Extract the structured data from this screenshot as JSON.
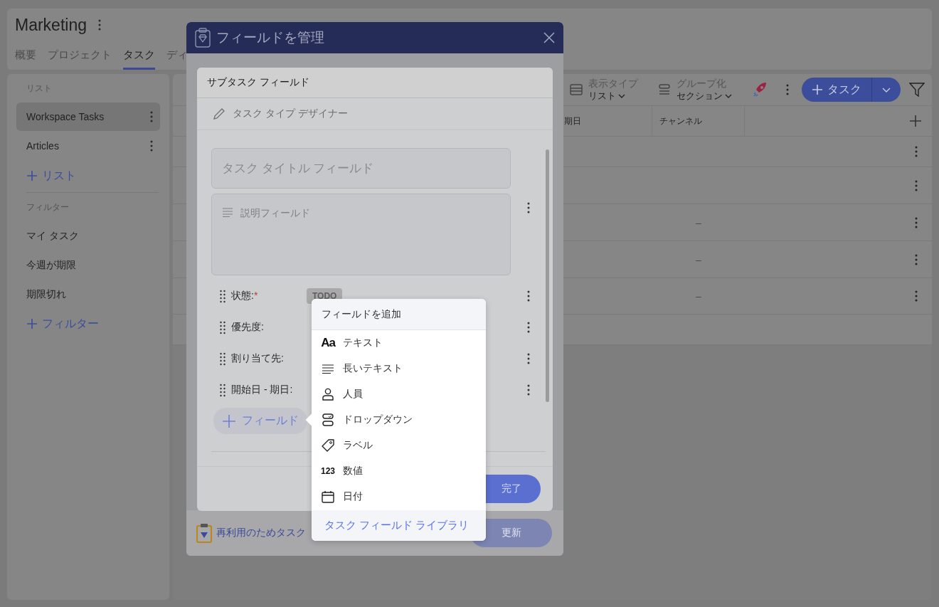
{
  "app": {
    "title": "Marketing",
    "tabs": [
      {
        "label": "概要",
        "selected": false
      },
      {
        "label": "プロジェクト",
        "selected": false
      },
      {
        "label": "タスク",
        "selected": true
      },
      {
        "label": "ディ",
        "selected": false
      }
    ]
  },
  "sidebar": {
    "lists_heading": "リスト",
    "lists": [
      {
        "label": "Workspace Tasks",
        "selected": true
      },
      {
        "label": "Articles",
        "selected": false
      }
    ],
    "add_list": "リスト",
    "filters_heading": "フィルター",
    "filters": [
      {
        "label": "マイ タスク"
      },
      {
        "label": "今週が期限"
      },
      {
        "label": "期限切れ"
      }
    ],
    "add_filter": "フィルター"
  },
  "toolbar": {
    "view_type": {
      "label": "表示タイプ",
      "value": "リスト"
    },
    "group_by": {
      "label": "グループ化",
      "value": "セクション"
    },
    "add_task": "タスク"
  },
  "table": {
    "columns": [
      "期日",
      "チャンネル"
    ],
    "rows": [
      {},
      {},
      {
        "channel": "–"
      },
      {
        "channel": "–"
      },
      {
        "channel": "–"
      }
    ]
  },
  "modal": {
    "title": "フィールドを管理",
    "footer_link": "再利用のためタスク",
    "update_button": "更新"
  },
  "dialog": {
    "title": "サブタスク フィールド",
    "designer_link": "タスク タイプ デザイナー",
    "title_placeholder": "タスク タイトル フィールド",
    "description_placeholder": "説明フィールド",
    "fields": [
      {
        "label": "状態:",
        "required_mark": "*",
        "value": "TODO"
      },
      {
        "label": "優先度:"
      },
      {
        "label": "割り当て先:"
      },
      {
        "label": "開始日 - 期日:"
      }
    ],
    "add_field": "フィールド",
    "done_button": "完了"
  },
  "popup": {
    "title": "フィールドを追加",
    "items": [
      {
        "kind": "text",
        "icon_text": "Aa",
        "label": "テキスト"
      },
      {
        "kind": "long_text",
        "label": "長いテキスト"
      },
      {
        "kind": "person",
        "label": "人員"
      },
      {
        "kind": "dropdown",
        "label": "ドロップダウン"
      },
      {
        "kind": "label",
        "label": "ラベル"
      },
      {
        "kind": "number",
        "icon_text": "123",
        "label": "数値"
      },
      {
        "kind": "date",
        "label": "日付"
      }
    ],
    "library_link": "タスク フィールド ライブラリ"
  }
}
